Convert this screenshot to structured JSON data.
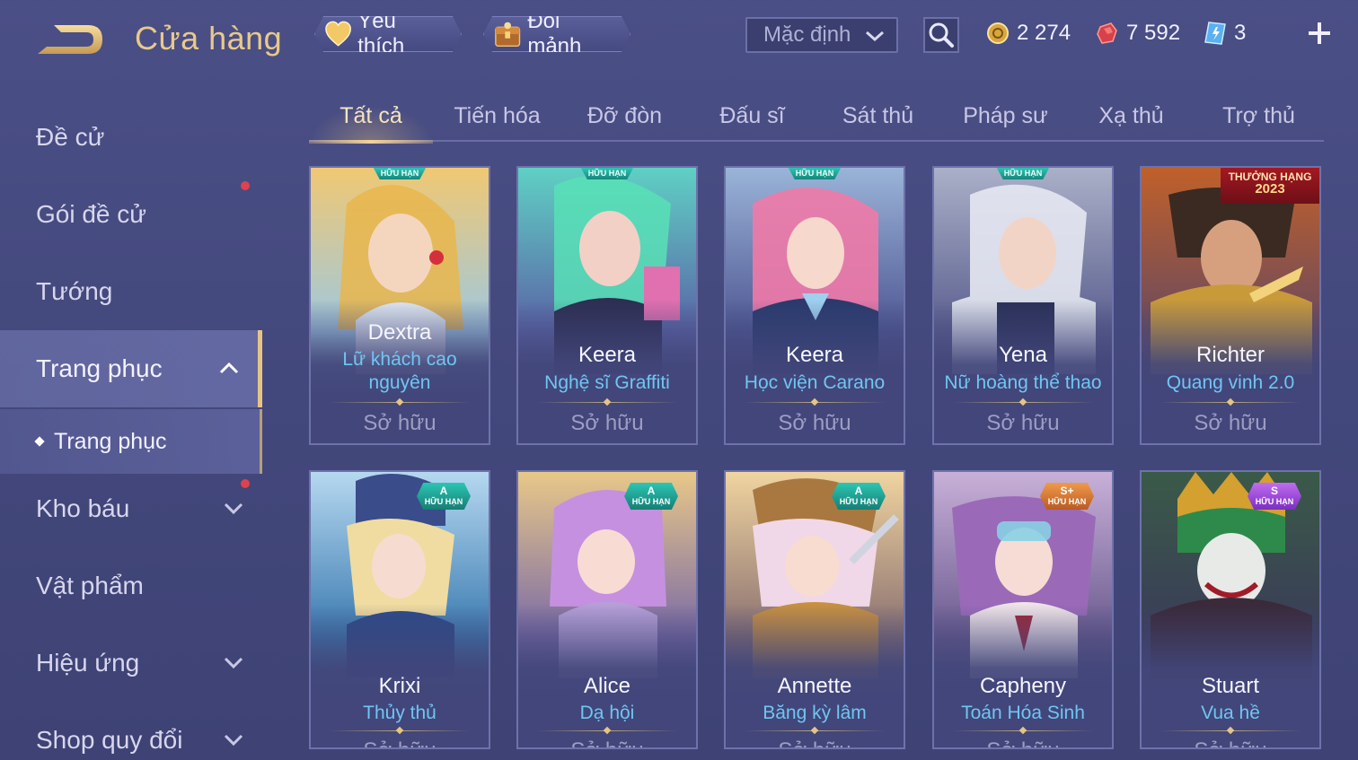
{
  "header": {
    "title": "Cửa hàng",
    "favorite_label": "Yêu thích",
    "exchange_label": "Đổi mảnh",
    "sort_value": "Mặc định",
    "currencies": {
      "gold": "2 274",
      "gems": "7 592",
      "tickets": "3"
    }
  },
  "sidebar": {
    "items": [
      {
        "label": "Đề cử"
      },
      {
        "label": "Gói đề cử"
      },
      {
        "label": "Tướng"
      },
      {
        "label": "Trang phục"
      },
      {
        "label": "Kho báu"
      },
      {
        "label": "Vật phẩm"
      },
      {
        "label": "Hiệu ứng"
      },
      {
        "label": "Shop quy đổi"
      }
    ],
    "sub_item": "Trang phục"
  },
  "tabs": [
    "Tất cả",
    "Tiến hóa",
    "Đỡ đòn",
    "Đấu sĩ",
    "Sát thủ",
    "Pháp sư",
    "Xạ thủ",
    "Trợ thủ"
  ],
  "active_tab": "Tất cả",
  "cards": [
    {
      "hero": "Dextra",
      "skin_line1": "Lữ khách cao",
      "skin_line2": "nguyên",
      "status": "Sở hữu",
      "badge": "HỮU HẠN"
    },
    {
      "hero": "Keera",
      "skin_line1": "Nghệ sĩ Graffiti",
      "status": "Sở hữu",
      "badge": "HỮU HẠN"
    },
    {
      "hero": "Keera",
      "skin_line1": "Học viện Carano",
      "status": "Sở hữu",
      "badge": "HỮU HẠN"
    },
    {
      "hero": "Yena",
      "skin_line1": "Nữ hoàng thể thao",
      "status": "Sở hữu",
      "badge": "HỮU HẠN"
    },
    {
      "hero": "Richter",
      "skin_line1": "Quang vinh 2.0",
      "status": "Sở hữu",
      "rank_badge": "THƯỞNG HẠNG",
      "rank_year": "2023"
    },
    {
      "hero": "Krixi",
      "skin_line1": "Thủy thủ",
      "status": "Sở hữu",
      "grade": "A",
      "grade_label": "HỮU HẠN"
    },
    {
      "hero": "Alice",
      "skin_line1": "Dạ hội",
      "status": "Sở hữu",
      "grade": "A",
      "grade_label": "HỮU HẠN"
    },
    {
      "hero": "Annette",
      "skin_line1": "Băng kỳ lâm",
      "status": "Sở hữu",
      "grade": "A",
      "grade_label": "HỮU HẠN"
    },
    {
      "hero": "Capheny",
      "skin_line1": "Toán Hóa Sinh",
      "status": "Sở hữu",
      "grade": "S+",
      "grade_label": "HỮU HẠN"
    },
    {
      "hero": "Stuart",
      "skin_line1": "Vua hề",
      "status": "Sở hữu",
      "grade": "S",
      "grade_label": "HỮU HẠN"
    }
  ],
  "colors": {
    "accent_gold": "#e9c98a",
    "skin_blue": "#6fc6f2",
    "badge_teal": "#2bc6b3",
    "notify_red": "#e0414d"
  }
}
